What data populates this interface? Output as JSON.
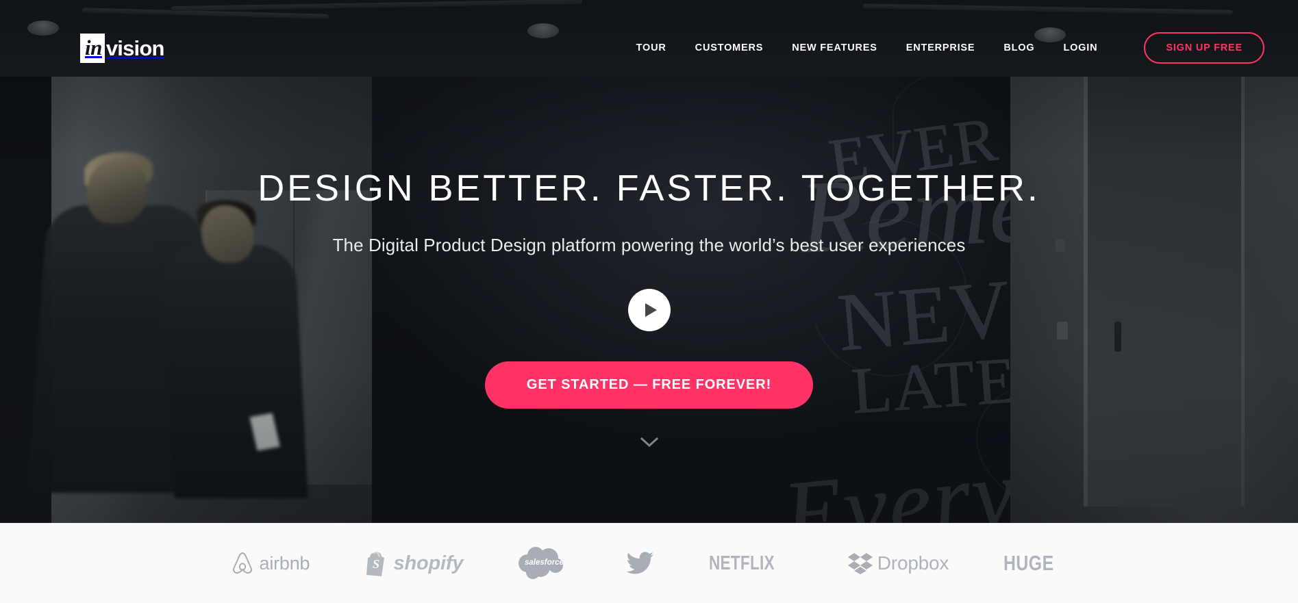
{
  "nav": {
    "logo": {
      "mark": "in",
      "word": "vision",
      "name": "invision-logo"
    },
    "links": [
      {
        "label": "TOUR"
      },
      {
        "label": "CUSTOMERS"
      },
      {
        "label": "NEW FEATURES"
      },
      {
        "label": "ENTERPRISE"
      },
      {
        "label": "BLOG"
      },
      {
        "label": "LOGIN"
      }
    ],
    "signup_label": "SIGN UP FREE",
    "signup_color": "#ff3366"
  },
  "hero": {
    "headline": "DESIGN BETTER. FASTER. TOGETHER.",
    "subhead": "The Digital Product Design platform powering the world’s best user experiences",
    "play_button_name": "play-video-button",
    "cta_label": "GET STARTED — FREE FOREVER!",
    "cta_color": "#ff3366",
    "scroll_hint_name": "scroll-down-chevron"
  },
  "logo_strip": {
    "background": "#fafafa",
    "logo_color": "#a9aeb5",
    "brands": [
      {
        "name": "airbnb",
        "label": "airbnb"
      },
      {
        "name": "shopify",
        "label": "shopify"
      },
      {
        "name": "salesforce",
        "label": "salesforce"
      },
      {
        "name": "twitter",
        "label": ""
      },
      {
        "name": "netflix",
        "label": "NETFLIX"
      },
      {
        "name": "dropbox",
        "label": "Dropbox"
      },
      {
        "name": "huge",
        "label": "HUGE"
      }
    ]
  }
}
